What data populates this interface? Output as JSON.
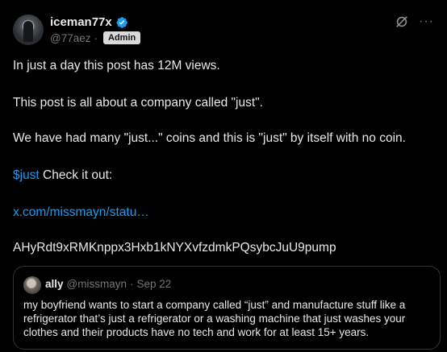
{
  "author": {
    "display_name": "iceman77x",
    "handle": "@77aez",
    "separator": "·",
    "role_badge": "Admin",
    "verified_icon": "verified-check-icon"
  },
  "actions": {
    "grok_icon": "grok-icon",
    "more_label": "···"
  },
  "post": {
    "line1": "In just a day this post has 12M views.",
    "line2": "This post is all about a company called \"just\".",
    "line3": "We have had many \"just...\" coins and this is \"just\" by itself with no coin.",
    "cashtag": "$just",
    "line4_rest": " Check it out:",
    "link": "x.com/missmayn/statu…",
    "address": "AHyRdt9xRMKnppx3Hxb1kNYXvfzdmkPQsybcJuU9pump"
  },
  "quote": {
    "display_name": "ally",
    "handle": "@missmayn",
    "separator": "·",
    "date": "Sep 22",
    "text": "my boyfriend wants to start a company called “just” and manufacture stuff like a refrigerator that’s just a refrigerator or a washing machine that just washes your clothes and their products have no tech and work for at least 15+ years."
  },
  "colors": {
    "background": "#000000",
    "text": "#e7e9ea",
    "muted": "#71767b",
    "link": "#1d9bf0",
    "verified": "#1d9bf0",
    "border": "#2f3336"
  }
}
